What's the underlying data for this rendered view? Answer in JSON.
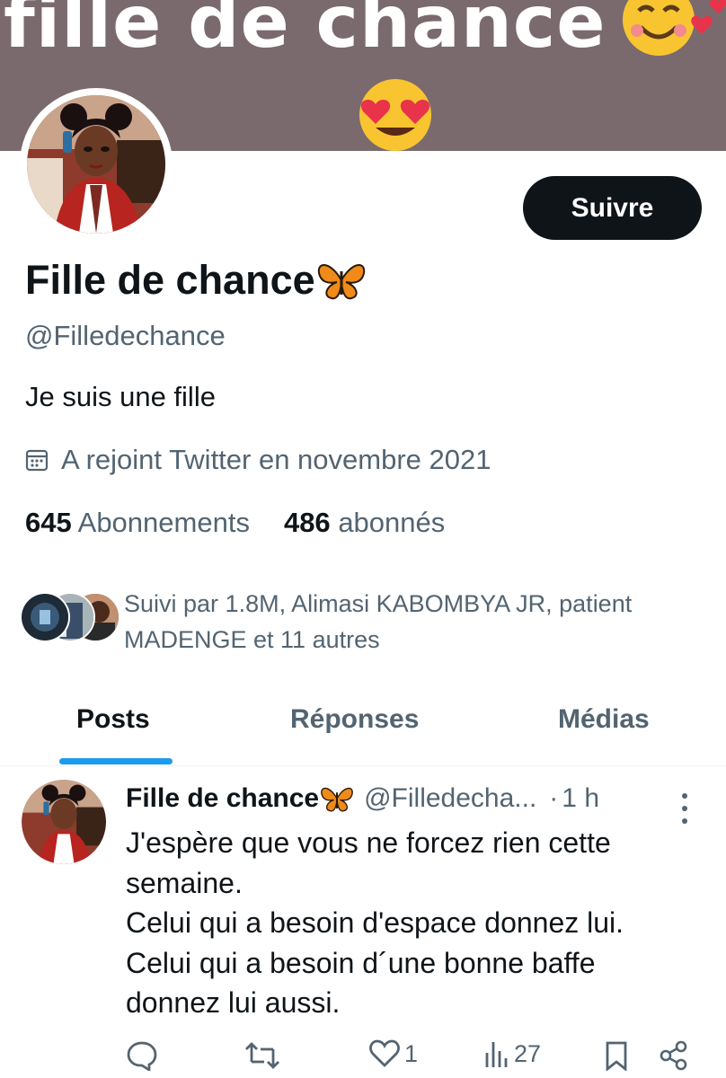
{
  "banner": {
    "text": "fille de chance"
  },
  "profile": {
    "display_name": "Fille de chance",
    "handle": "@Filledechance",
    "bio": "Je suis une fille",
    "joined": "A rejoint Twitter en novembre 2021",
    "following_count": "645",
    "following_label": "Abonnements",
    "followers_count": "486",
    "followers_label": "abonnés",
    "followed_by": "Suivi par 1.8M, Alimasi KABOMBYA JR, patient MADENGE et 11 autres"
  },
  "follow_button": {
    "label": "Suivre"
  },
  "tabs": [
    {
      "label": "Posts",
      "active": true
    },
    {
      "label": "Réponses",
      "active": false
    },
    {
      "label": "Médias",
      "active": false
    }
  ],
  "tweet": {
    "author_name": "Fille de chance",
    "author_handle": "@Filledecha...",
    "separator": "·",
    "time": "1 h",
    "lines": [
      "J'espère que vous ne forcez rien cette",
      "semaine.",
      "Celui qui a besoin d'espace donnez lui.",
      "Celui qui a besoin d´une bonne baffe",
      "donnez lui aussi."
    ],
    "like_count": "1",
    "view_count": "27"
  },
  "icons": {
    "banner_emojis": [
      "smiling-face-with-hearts-icon",
      "heart-eyes-icon"
    ],
    "name_emoji": "butterfly-icon",
    "joined": "calendar-icon",
    "actions": [
      "reply-icon",
      "retweet-icon",
      "like-icon",
      "views-icon",
      "bookmark-icon",
      "share-icon"
    ]
  },
  "colors": {
    "accent": "#1d9bf0",
    "text_primary": "#0f1419",
    "text_secondary": "#536471",
    "banner": "#7a6a6e",
    "button_bg": "#0f1419"
  }
}
